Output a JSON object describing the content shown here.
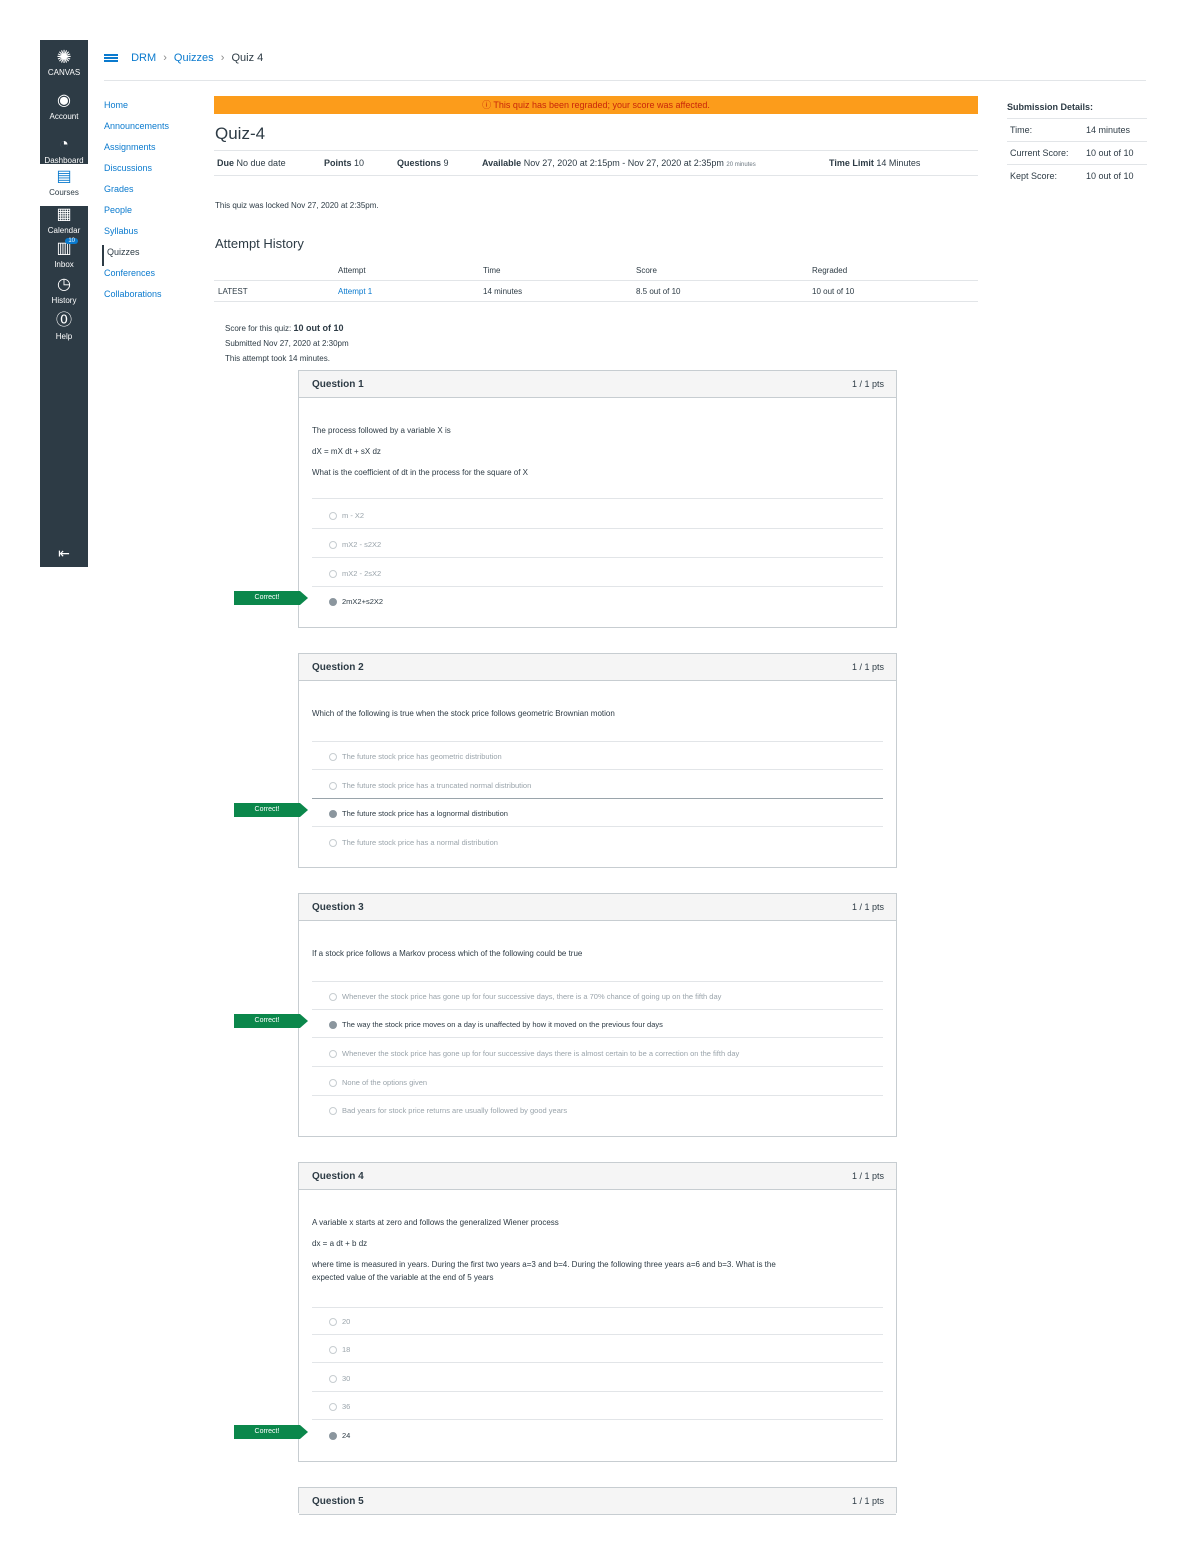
{
  "global_nav": {
    "logo_label": "CANVAS",
    "items": [
      {
        "label": "Account",
        "icon": "account-icon"
      },
      {
        "label": "Dashboard",
        "icon": "dashboard-icon"
      },
      {
        "label": "Courses",
        "icon": "courses-icon"
      },
      {
        "label": "Calendar",
        "icon": "calendar-icon"
      },
      {
        "label": "Inbox",
        "icon": "inbox-icon",
        "badge": "10"
      },
      {
        "label": "History",
        "icon": "history-icon"
      },
      {
        "label": "Help",
        "icon": "help-icon"
      }
    ]
  },
  "breadcrumb": {
    "course": "DRM",
    "section": "Quizzes",
    "page": "Quiz 4"
  },
  "course_nav": [
    "Home",
    "Announcements",
    "Assignments",
    "Discussions",
    "Grades",
    "People",
    "Syllabus",
    "Quizzes",
    "Conferences",
    "Collaborations"
  ],
  "banner": "ⓘ This quiz has been regraded; your score was affected.",
  "quiz": {
    "title": "Quiz-4",
    "due_label": "Due",
    "due": "No due date",
    "points_label": "Points",
    "points": "10",
    "questions_label": "Questions",
    "questions": "9",
    "available_label": "Available",
    "available": "Nov 27, 2020 at 2:15pm - Nov 27, 2020 at 2:35pm",
    "available_suffix": "20 minutes",
    "time_limit_label": "Time Limit",
    "time_limit": "14 Minutes",
    "locked_note": "This quiz was locked Nov 27, 2020 at 2:35pm."
  },
  "attempt_history": {
    "title": "Attempt History",
    "headers": [
      "",
      "Attempt",
      "Time",
      "Score",
      "Regraded"
    ],
    "rows": [
      {
        "tag": "LATEST",
        "attempt": "Attempt 1",
        "time": "14 minutes",
        "score": "8.5 out of 10",
        "regraded": "10 out of 10"
      }
    ]
  },
  "score_block": {
    "score_label": "Score for this quiz:",
    "score": "10 out of 10",
    "submitted": "Submitted Nov 27, 2020 at 2:30pm",
    "duration": "This attempt took 14 minutes."
  },
  "correct_label": "Correct!",
  "questions": [
    {
      "name": "Question 1",
      "pts": "1 / 1 pts",
      "text": [
        "The process followed by a variable X is",
        "dX = mX dt + sX dz",
        "What is the coefficient of dt in the process for the square of X"
      ],
      "answers": [
        "m - X2",
        "mX2 - s2X2",
        "mX2 - 2sX2",
        "2mX2+s2X2"
      ]
    },
    {
      "name": "Question 2",
      "pts": "1 / 1 pts",
      "text": [
        "Which of the following is true when the stock price follows geometric Brownian motion"
      ],
      "answers": [
        "The future stock price has geometric distribution",
        "The future stock price has a truncated normal distribution",
        "The future stock price has a lognormal distribution",
        "The future stock price has a normal distribution"
      ]
    },
    {
      "name": "Question 3",
      "pts": "1 / 1 pts",
      "text": [
        "If a stock price follows a Markov process which of the following could be true"
      ],
      "answers": [
        "Whenever the stock price has gone up for four successive days, there is a 70% chance of going up on the fifth day",
        "The way the stock price moves on a day is unaffected by how it moved on the previous four days",
        "Whenever the stock price has gone up for four successive days there is almost certain to be a correction on the fifth day",
        "None of the options given",
        "Bad years for stock price returns are usually followed by good years"
      ]
    },
    {
      "name": "Question 4",
      "pts": "1 / 1 pts",
      "text": [
        "A variable x starts at zero and follows the generalized Wiener process",
        "dx = a dt + b dz",
        "where time is measured in years. During the first two years a=3 and b=4. During the following three years a=6 and b=3. What is the",
        "expected value of the variable at the end of 5 years"
      ],
      "answers": [
        "20",
        "18",
        "30",
        "36",
        "24"
      ]
    },
    {
      "name": "Question 5",
      "pts": "1 / 1 pts"
    }
  ],
  "submission_details": {
    "title": "Submission Details:",
    "rows": [
      {
        "label": "Time:",
        "value": "14 minutes"
      },
      {
        "label": "Current Score:",
        "value": "10 out of 10"
      },
      {
        "label": "Kept Score:",
        "value": "10 out of 10"
      }
    ]
  },
  "colors": {
    "nav_bg": "#2d3b45",
    "link": "#0a7ace",
    "banner": "#fc9c1b",
    "correct": "#0b874b"
  }
}
